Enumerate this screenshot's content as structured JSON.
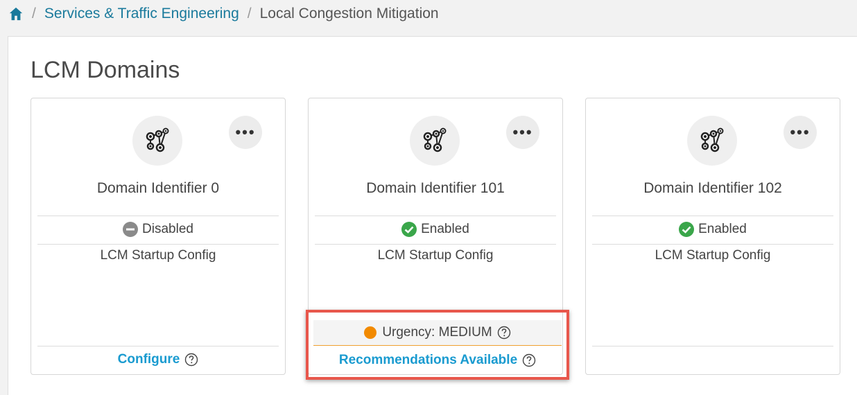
{
  "breadcrumb": {
    "home_icon": "home-icon",
    "separator": "/",
    "items": [
      {
        "label": "Services & Traffic Engineering"
      },
      {
        "label": "Local Congestion Mitigation"
      }
    ]
  },
  "page": {
    "title": "LCM Domains"
  },
  "cards": [
    {
      "name": "Domain Identifier 0",
      "more_label": "•••",
      "status": "Disabled",
      "status_color": "#8a8a8a",
      "config_label": "LCM Startup Config",
      "footer_link": "Configure"
    },
    {
      "name": "Domain Identifier 101",
      "more_label": "•••",
      "status": "Enabled",
      "status_color": "#3aa64a",
      "config_label": "LCM Startup Config",
      "urgency": "Urgency: MEDIUM",
      "urgency_color": "#f28a00",
      "recommendations_link": "Recommendations Available"
    },
    {
      "name": "Domain Identifier 102",
      "more_label": "•••",
      "status": "Enabled",
      "status_color": "#3aa64a",
      "config_label": "LCM Startup Config"
    }
  ],
  "colors": {
    "link": "#1a9bd0",
    "breadcrumb_link": "#1a7a9c",
    "highlight": "#e8574c"
  }
}
